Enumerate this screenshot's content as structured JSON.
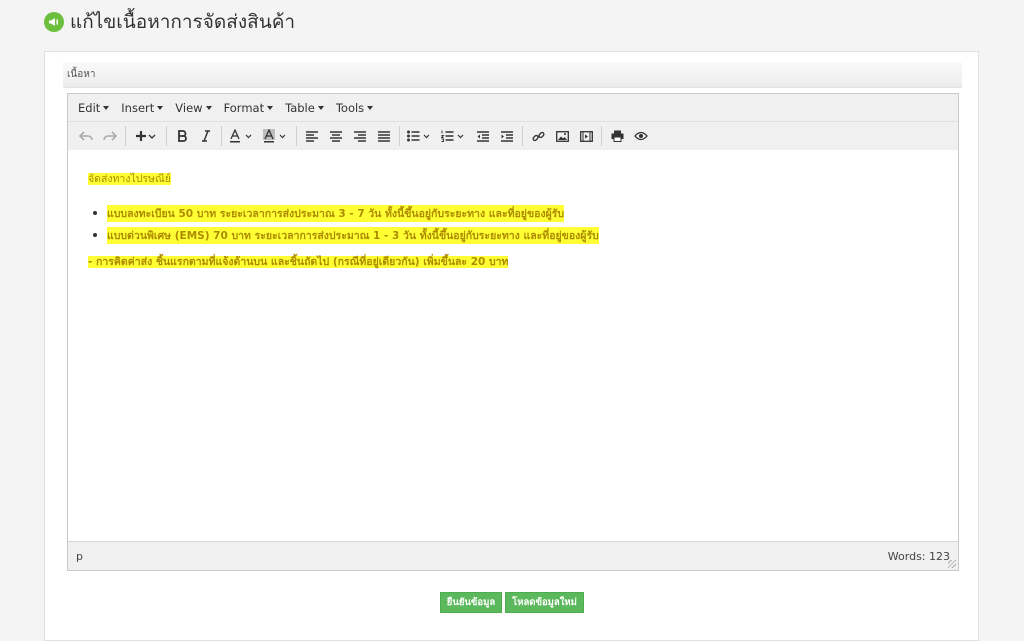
{
  "header": {
    "title": "แก้ไขเนื้อหาการจัดส่งสินค้า",
    "icon": "megaphone-icon"
  },
  "section": {
    "label": "เนื้อหา"
  },
  "menubar": [
    {
      "label": "Edit"
    },
    {
      "label": "Insert"
    },
    {
      "label": "View"
    },
    {
      "label": "Format"
    },
    {
      "label": "Table"
    },
    {
      "label": "Tools"
    }
  ],
  "content": {
    "heading": "จัดส่งทางไปรษณีย์",
    "bullets": [
      "แบบลงทะเบียน 50 บาท ระยะเวลาการส่งประมาณ 3 - 7 วัน ทั้งนี้ขึ้นอยู่กับระยะทาง และที่อยู่ของผู้รับ",
      "แบบด่วนพิเศษ (EMS) 70 บาท ระยะเวลาการส่งประมาณ 1 - 3 วัน ทั้งนี้ขึ้นอยู่กับระยะทาง และที่อยู่ของผู้รับ"
    ],
    "note": "- การคิดค่าส่ง ชิ้นแรกตามที่แจ้งด้านบน และชิ้นถัดไป (กรณีที่อยู่เดียวกัน) เพิ่มขึ้นละ 20 บาท"
  },
  "statusbar": {
    "path": "p",
    "words": "Words: 123"
  },
  "buttons": {
    "confirm": "ยืนยันข้อมูล",
    "reload": "โหลดข้อมูลใหม่"
  },
  "colors": {
    "highlight": "#ffff33",
    "highlight_text": "#ad8b00",
    "button": "#5cb85c",
    "icon": "#6cbf3c"
  }
}
